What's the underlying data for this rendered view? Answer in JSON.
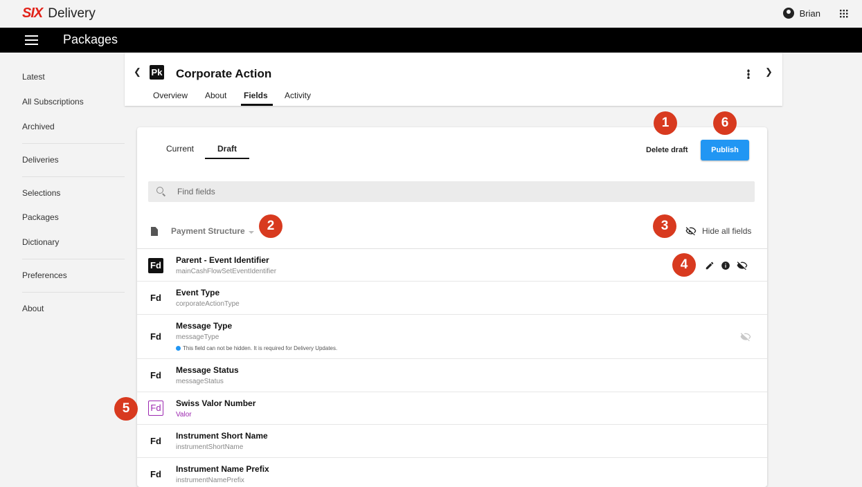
{
  "brand": {
    "logo": "SIX",
    "name": "Delivery"
  },
  "user": {
    "name": "Brian"
  },
  "topnav": {
    "title": "Packages"
  },
  "sidebar": {
    "items": [
      "Latest",
      "All Subscriptions",
      "Archived",
      "Deliveries",
      "Selections",
      "Packages",
      "Dictionary",
      "Preferences",
      "About"
    ]
  },
  "header": {
    "badge": "Pk",
    "title": "Corporate Action",
    "tabs": [
      "Overview",
      "About",
      "Fields",
      "Activity"
    ],
    "active_tab": "Fields"
  },
  "panel": {
    "subtabs": [
      "Current",
      "Draft"
    ],
    "active_subtab": "Draft",
    "delete_label": "Delete draft",
    "publish_label": "Publish",
    "search_placeholder": "Find fields",
    "group_title": "Payment Structure",
    "hide_all_label": "Hide all fields"
  },
  "fields": [
    {
      "badge": "Fd",
      "title": "Parent - Event Identifier",
      "sub": "mainCashFlowSetEventIdentifier"
    },
    {
      "badge": "Fd",
      "title": "Event Type",
      "sub": "corporateActionType"
    },
    {
      "badge": "Fd",
      "title": "Message Type",
      "sub": "messageType",
      "note": "This field can not be hidden. It is required for Delivery Updates."
    },
    {
      "badge": "Fd",
      "title": "Message Status",
      "sub": "messageStatus"
    },
    {
      "badge": "Fd",
      "title": "Swiss Valor Number",
      "sub": "Valor"
    },
    {
      "badge": "Fd",
      "title": "Instrument Short Name",
      "sub": "instrumentShortName"
    },
    {
      "badge": "Fd",
      "title": "Instrument Name Prefix",
      "sub": "instrumentNamePrefix"
    }
  ],
  "callouts": [
    "1",
    "2",
    "3",
    "4",
    "5",
    "6"
  ],
  "colors": {
    "accent": "#2196f3",
    "callout": "#d83a1f",
    "brand": "#e2231a",
    "highlight": "#9c27b0"
  }
}
